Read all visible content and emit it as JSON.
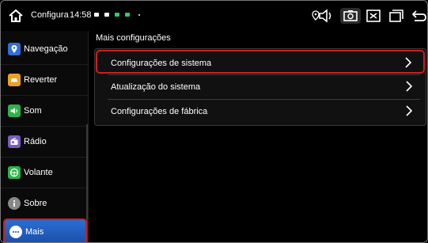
{
  "status_bar": {
    "app_title": "Configura",
    "time": "14:58"
  },
  "sidebar": {
    "items": [
      {
        "label": "Navegação",
        "icon": "map-icon",
        "color": "#2f6fd6"
      },
      {
        "label": "Reverter",
        "icon": "car-icon",
        "color": "#f0a020"
      },
      {
        "label": "Som",
        "icon": "speaker-icon",
        "color": "#2db34a"
      },
      {
        "label": "Rádio",
        "icon": "radio-icon",
        "color": "#7a5cc6"
      },
      {
        "label": "Volante",
        "icon": "steering-wheel-icon",
        "color": "#2db34a"
      },
      {
        "label": "Sobre",
        "icon": "info-icon",
        "color": "#888888"
      },
      {
        "label": "Mais",
        "icon": "more-icon",
        "color": "#3b8be8"
      }
    ],
    "active": "Mais"
  },
  "main": {
    "section_title": "Mais configurações",
    "rows": [
      {
        "label": "Configurações de sistema"
      },
      {
        "label": "Atualização do sistema"
      },
      {
        "label": "Configurações de fábrica"
      }
    ]
  },
  "colors": {
    "highlight_border": "#d01d1d",
    "active_item": "#2a6ed3"
  }
}
